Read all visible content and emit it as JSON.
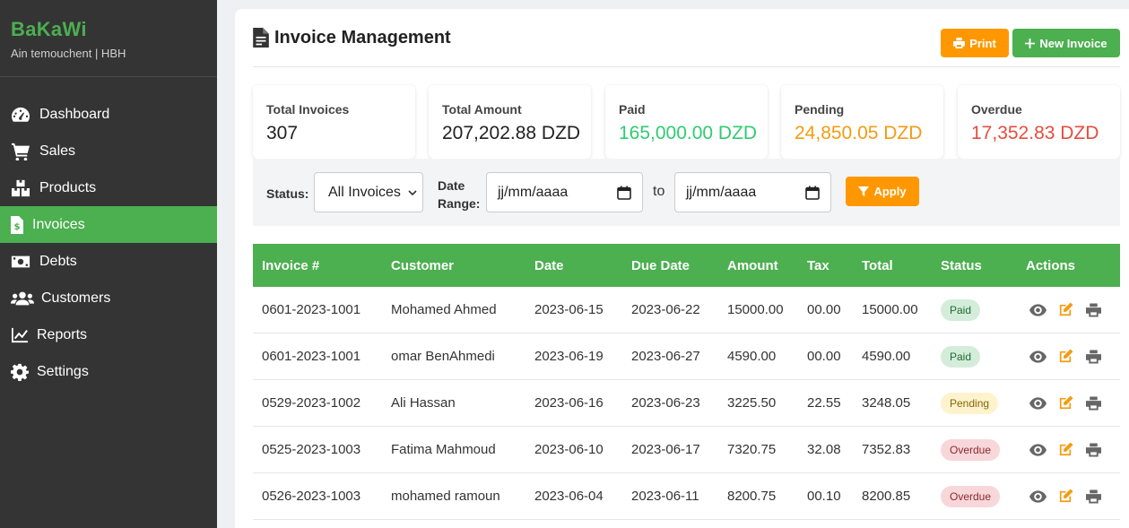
{
  "sidebar": {
    "brand": "BaKaWi",
    "subtitle": "Ain temouchent | HBH",
    "items": [
      {
        "label": "Dashboard",
        "icon": "gauge-icon"
      },
      {
        "label": "Sales",
        "icon": "cart-icon"
      },
      {
        "label": "Products",
        "icon": "boxes-icon"
      },
      {
        "label": "Invoices",
        "icon": "invoice-icon",
        "active": true
      },
      {
        "label": "Debts",
        "icon": "money-icon"
      },
      {
        "label": "Customers",
        "icon": "users-icon"
      },
      {
        "label": "Reports",
        "icon": "chart-line-icon"
      },
      {
        "label": "Settings",
        "icon": "gear-icon"
      }
    ]
  },
  "header": {
    "title": "Invoice Management",
    "print_label": "Print",
    "new_label": "New Invoice"
  },
  "stats": [
    {
      "label": "Total Invoices",
      "value": "307"
    },
    {
      "label": "Total Amount",
      "value": "207,202.88 DZD"
    },
    {
      "label": "Paid",
      "value": "165,000.00 DZD"
    },
    {
      "label": "Pending",
      "value": "24,850.05 DZD"
    },
    {
      "label": "Overdue",
      "value": "17,352.83 DZD"
    }
  ],
  "filters": {
    "status_label": "Status:",
    "status_value": "All Invoices",
    "date_label_1": "Date",
    "date_label_2": "Range:",
    "date_from": "jj/mm/aaaa",
    "to_label": "to",
    "date_to": "jj/mm/aaaa",
    "apply_label": "Apply"
  },
  "table": {
    "columns": [
      "Invoice #",
      "Customer",
      "Date",
      "Due Date",
      "Amount",
      "Tax",
      "Total",
      "Status",
      "Actions"
    ],
    "rows": [
      [
        "0601-2023-1001",
        "Mohamed Ahmed",
        "2023-06-15",
        "2023-06-22",
        "15000.00",
        "00.00",
        "15000.00",
        "Paid"
      ],
      [
        "0601-2023-1001",
        "omar BenAhmedi",
        "2023-06-19",
        "2023-06-27",
        "4590.00",
        "00.00",
        "4590.00",
        "Paid"
      ],
      [
        "0529-2023-1002",
        "Ali Hassan",
        "2023-06-16",
        "2023-06-23",
        "3225.50",
        "22.55",
        "3248.05",
        "Pending"
      ],
      [
        "0525-2023-1003",
        "Fatima Mahmoud",
        "2023-06-10",
        "2023-06-17",
        "7320.75",
        "32.08",
        "7352.83",
        "Overdue"
      ],
      [
        "0526-2023-1003",
        "mohamed ramoun",
        "2023-06-04",
        "2023-06-11",
        "8200.75",
        "00.10",
        "8200.85",
        "Overdue"
      ]
    ]
  },
  "colors": {
    "brand_green": "#4caf50",
    "sidebar_bg": "#343434",
    "accent_orange": "#ff9800",
    "paid_green": "#2ecc71",
    "pending_orange": "#f39c12",
    "overdue_red": "#e74c3c"
  }
}
